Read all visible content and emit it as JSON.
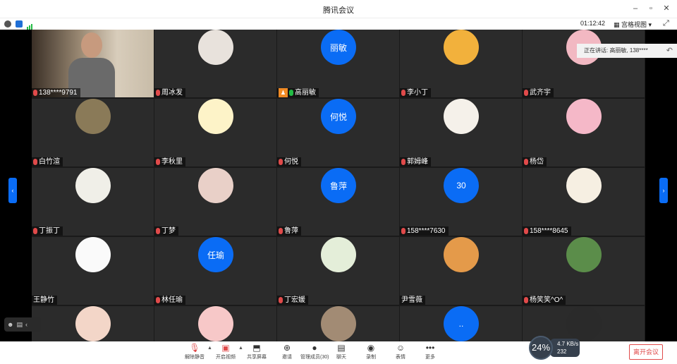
{
  "window": {
    "title": "腾讯会议"
  },
  "infobar": {
    "timer": "01:12:42",
    "view_mode": "宫格视图"
  },
  "speaking": {
    "text": "正在讲话: 高丽敏, 138****"
  },
  "participants": [
    {
      "name": "138****9791",
      "mic": "red",
      "avatar_type": "video",
      "avatar_icon": "camera-feed"
    },
    {
      "name": "周冰发",
      "mic": "red",
      "avatar_type": "image",
      "avatar_icon": "sketch-portrait-avatar"
    },
    {
      "name": "高丽敏",
      "mic": "green",
      "host": true,
      "avatar_type": "text",
      "avatar_text": "丽敏"
    },
    {
      "name": "李小丁",
      "mic": "red",
      "avatar_type": "image",
      "avatar_icon": "winnie-pooh-avatar"
    },
    {
      "name": "武齐宇",
      "mic": "red",
      "avatar_type": "image",
      "avatar_icon": "cartoon-avatar"
    },
    {
      "name": "白竹渲",
      "mic": "red",
      "avatar_type": "image",
      "avatar_icon": "landscape-avatar"
    },
    {
      "name": "李秋里",
      "mic": "red",
      "avatar_type": "image",
      "avatar_icon": "cat-avatar"
    },
    {
      "name": "何悦",
      "mic": "red",
      "avatar_type": "text",
      "avatar_text": "何悦"
    },
    {
      "name": "郭姆峰",
      "mic": "red",
      "avatar_type": "image",
      "avatar_icon": "dog-emoji-avatar"
    },
    {
      "name": "杨岱",
      "mic": "red",
      "avatar_type": "image",
      "avatar_icon": "pink-split-avatar"
    },
    {
      "name": "丁振丁",
      "mic": "red",
      "avatar_type": "image",
      "avatar_icon": "cartoon-girl-avatar"
    },
    {
      "name": "丁梦",
      "mic": "red",
      "avatar_type": "image",
      "avatar_icon": "pepsi-avatar"
    },
    {
      "name": "鲁萍",
      "mic": "red",
      "avatar_type": "text",
      "avatar_text": "鲁萍"
    },
    {
      "name": "158****7630",
      "mic": "red",
      "avatar_type": "text",
      "avatar_text": "30"
    },
    {
      "name": "158****8645",
      "mic": "red",
      "avatar_type": "image",
      "avatar_icon": "owl-avatar"
    },
    {
      "name": "王静竹",
      "mic": "none",
      "avatar_type": "image",
      "avatar_icon": "hand-sketch-avatar"
    },
    {
      "name": "林任瑜",
      "mic": "red",
      "avatar_type": "text",
      "avatar_text": "任瑜"
    },
    {
      "name": "丁宏媛",
      "mic": "red",
      "avatar_type": "image",
      "avatar_icon": "plant-avatar"
    },
    {
      "name": "尹雪薇",
      "mic": "none",
      "avatar_type": "image",
      "avatar_icon": "sunset-avatar"
    },
    {
      "name": "杨笑笑^O^",
      "mic": "red",
      "avatar_type": "image",
      "avatar_icon": "road-landscape-avatar"
    },
    {
      "name": "",
      "mic": "none",
      "avatar_type": "image",
      "avatar_icon": "boy-avatar"
    },
    {
      "name": "",
      "mic": "none",
      "avatar_type": "image",
      "avatar_icon": "cartoon-face-avatar"
    },
    {
      "name": "",
      "mic": "none",
      "avatar_type": "image",
      "avatar_icon": "panda-avatar"
    },
    {
      "name": "",
      "mic": "none",
      "avatar_type": "text",
      "avatar_text": ".."
    },
    {
      "name": "",
      "mic": "none",
      "avatar_type": "image",
      "avatar_icon": "person-standing-avatar"
    }
  ],
  "toolbar": {
    "unmute": "解除静音",
    "video": "开启视频",
    "share": "共享屏幕",
    "invite": "邀请",
    "members": "管理成员(30)",
    "chat": "聊天",
    "record": "录制",
    "reaction": "表情",
    "more": "更多",
    "leave": "离开会议"
  },
  "netmon": {
    "percent": "24%",
    "up": "4.7 KB/s",
    "down": "232 KB/s"
  }
}
